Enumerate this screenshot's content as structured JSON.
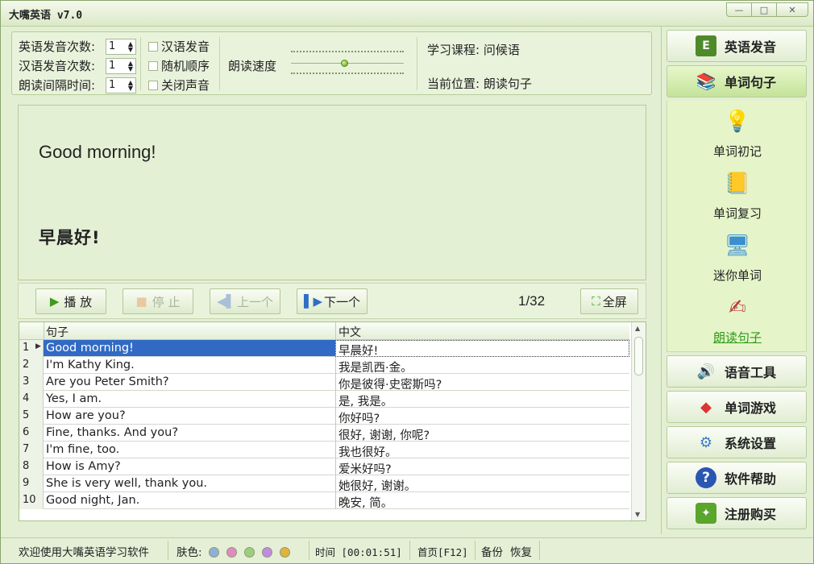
{
  "app": {
    "title": "大嘴英语 v7.0"
  },
  "settings": {
    "en_count_label": "英语发音次数:",
    "en_count_value": "1",
    "cn_count_label": "汉语发音次数:",
    "cn_count_value": "1",
    "interval_label": "朗读间隔时间:",
    "interval_value": "1",
    "chk_cn": "汉语发音",
    "chk_random": "随机顺序",
    "chk_mute": "关闭声音",
    "speed_label": "朗读速度",
    "speed_level": 0.47,
    "course": "学习课程: 问候语",
    "position": "当前位置: 朗读句子"
  },
  "display": {
    "english": "Good morning!",
    "chinese": "早晨好!"
  },
  "controls": {
    "play": "播 放",
    "stop": "停 止",
    "prev": "上一个",
    "next": "下一个",
    "counter": "1/32",
    "fullscreen": "全屏"
  },
  "table": {
    "col_en": "句子",
    "col_cn": "中文",
    "rows": [
      {
        "n": "1",
        "en": "Good morning!",
        "cn": "早晨好!"
      },
      {
        "n": "2",
        "en": "I'm Kathy King.",
        "cn": "我是凯西·金。"
      },
      {
        "n": "3",
        "en": "Are you Peter Smith?",
        "cn": "你是彼得·史密斯吗?"
      },
      {
        "n": "4",
        "en": "Yes, I am.",
        "cn": "是, 我是。"
      },
      {
        "n": "5",
        "en": "How are you?",
        "cn": "你好吗?"
      },
      {
        "n": "6",
        "en": "Fine, thanks. And you?",
        "cn": "很好, 谢谢, 你呢?"
      },
      {
        "n": "7",
        "en": "I'm fine, too.",
        "cn": "我也很好。"
      },
      {
        "n": "8",
        "en": "How is Amy?",
        "cn": "爱米好吗?"
      },
      {
        "n": "9",
        "en": "She is very well, thank you.",
        "cn": "她很好, 谢谢。"
      },
      {
        "n": "10",
        "en": "Good night, Jan.",
        "cn": "晚安, 简。"
      }
    ]
  },
  "sidebar": {
    "nav": [
      {
        "label": "英语发音",
        "icon": "book-e-icon"
      },
      {
        "label": "单词句子",
        "icon": "books-icon"
      },
      {
        "label": "语音工具",
        "icon": "speaker-icon"
      },
      {
        "label": "单词游戏",
        "icon": "game-icon"
      },
      {
        "label": "系统设置",
        "icon": "gear-icon"
      },
      {
        "label": "软件帮助",
        "icon": "help-icon"
      },
      {
        "label": "注册购买",
        "icon": "register-icon"
      }
    ],
    "sub": [
      {
        "label": "单词初记",
        "icon": "bulb-icon"
      },
      {
        "label": "单词复习",
        "icon": "review-icon"
      },
      {
        "label": "迷你单词",
        "icon": "monitor-icon"
      },
      {
        "label": "朗读句子",
        "icon": "pen-book-icon"
      }
    ]
  },
  "status": {
    "welcome": "欢迎使用大嘴英语学习软件",
    "skin_label": "肤色:",
    "skin_colors": [
      "#8fb0d6",
      "#e08bbd",
      "#9ccf7a",
      "#c28be0",
      "#e0b43a"
    ],
    "time": "时间 [00:01:51]",
    "home": "首页[F12]",
    "backup": "备份",
    "restore": "恢复"
  }
}
